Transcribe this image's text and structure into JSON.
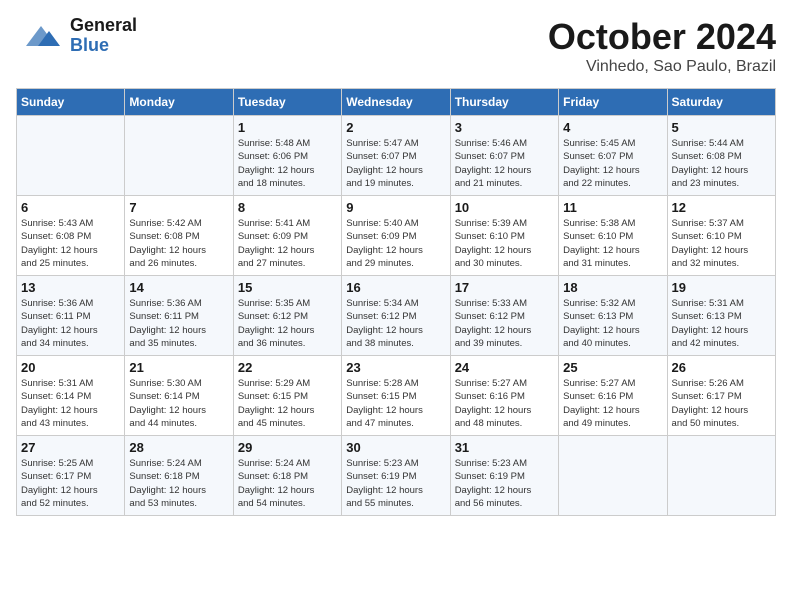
{
  "header": {
    "title": "October 2024",
    "subtitle": "Vinhedo, Sao Paulo, Brazil",
    "logo_general": "General",
    "logo_blue": "Blue"
  },
  "calendar": {
    "days_of_week": [
      "Sunday",
      "Monday",
      "Tuesday",
      "Wednesday",
      "Thursday",
      "Friday",
      "Saturday"
    ],
    "weeks": [
      [
        {
          "num": "",
          "detail": ""
        },
        {
          "num": "",
          "detail": ""
        },
        {
          "num": "1",
          "detail": "Sunrise: 5:48 AM\nSunset: 6:06 PM\nDaylight: 12 hours\nand 18 minutes."
        },
        {
          "num": "2",
          "detail": "Sunrise: 5:47 AM\nSunset: 6:07 PM\nDaylight: 12 hours\nand 19 minutes."
        },
        {
          "num": "3",
          "detail": "Sunrise: 5:46 AM\nSunset: 6:07 PM\nDaylight: 12 hours\nand 21 minutes."
        },
        {
          "num": "4",
          "detail": "Sunrise: 5:45 AM\nSunset: 6:07 PM\nDaylight: 12 hours\nand 22 minutes."
        },
        {
          "num": "5",
          "detail": "Sunrise: 5:44 AM\nSunset: 6:08 PM\nDaylight: 12 hours\nand 23 minutes."
        }
      ],
      [
        {
          "num": "6",
          "detail": "Sunrise: 5:43 AM\nSunset: 6:08 PM\nDaylight: 12 hours\nand 25 minutes."
        },
        {
          "num": "7",
          "detail": "Sunrise: 5:42 AM\nSunset: 6:08 PM\nDaylight: 12 hours\nand 26 minutes."
        },
        {
          "num": "8",
          "detail": "Sunrise: 5:41 AM\nSunset: 6:09 PM\nDaylight: 12 hours\nand 27 minutes."
        },
        {
          "num": "9",
          "detail": "Sunrise: 5:40 AM\nSunset: 6:09 PM\nDaylight: 12 hours\nand 29 minutes."
        },
        {
          "num": "10",
          "detail": "Sunrise: 5:39 AM\nSunset: 6:10 PM\nDaylight: 12 hours\nand 30 minutes."
        },
        {
          "num": "11",
          "detail": "Sunrise: 5:38 AM\nSunset: 6:10 PM\nDaylight: 12 hours\nand 31 minutes."
        },
        {
          "num": "12",
          "detail": "Sunrise: 5:37 AM\nSunset: 6:10 PM\nDaylight: 12 hours\nand 32 minutes."
        }
      ],
      [
        {
          "num": "13",
          "detail": "Sunrise: 5:36 AM\nSunset: 6:11 PM\nDaylight: 12 hours\nand 34 minutes."
        },
        {
          "num": "14",
          "detail": "Sunrise: 5:36 AM\nSunset: 6:11 PM\nDaylight: 12 hours\nand 35 minutes."
        },
        {
          "num": "15",
          "detail": "Sunrise: 5:35 AM\nSunset: 6:12 PM\nDaylight: 12 hours\nand 36 minutes."
        },
        {
          "num": "16",
          "detail": "Sunrise: 5:34 AM\nSunset: 6:12 PM\nDaylight: 12 hours\nand 38 minutes."
        },
        {
          "num": "17",
          "detail": "Sunrise: 5:33 AM\nSunset: 6:12 PM\nDaylight: 12 hours\nand 39 minutes."
        },
        {
          "num": "18",
          "detail": "Sunrise: 5:32 AM\nSunset: 6:13 PM\nDaylight: 12 hours\nand 40 minutes."
        },
        {
          "num": "19",
          "detail": "Sunrise: 5:31 AM\nSunset: 6:13 PM\nDaylight: 12 hours\nand 42 minutes."
        }
      ],
      [
        {
          "num": "20",
          "detail": "Sunrise: 5:31 AM\nSunset: 6:14 PM\nDaylight: 12 hours\nand 43 minutes."
        },
        {
          "num": "21",
          "detail": "Sunrise: 5:30 AM\nSunset: 6:14 PM\nDaylight: 12 hours\nand 44 minutes."
        },
        {
          "num": "22",
          "detail": "Sunrise: 5:29 AM\nSunset: 6:15 PM\nDaylight: 12 hours\nand 45 minutes."
        },
        {
          "num": "23",
          "detail": "Sunrise: 5:28 AM\nSunset: 6:15 PM\nDaylight: 12 hours\nand 47 minutes."
        },
        {
          "num": "24",
          "detail": "Sunrise: 5:27 AM\nSunset: 6:16 PM\nDaylight: 12 hours\nand 48 minutes."
        },
        {
          "num": "25",
          "detail": "Sunrise: 5:27 AM\nSunset: 6:16 PM\nDaylight: 12 hours\nand 49 minutes."
        },
        {
          "num": "26",
          "detail": "Sunrise: 5:26 AM\nSunset: 6:17 PM\nDaylight: 12 hours\nand 50 minutes."
        }
      ],
      [
        {
          "num": "27",
          "detail": "Sunrise: 5:25 AM\nSunset: 6:17 PM\nDaylight: 12 hours\nand 52 minutes."
        },
        {
          "num": "28",
          "detail": "Sunrise: 5:24 AM\nSunset: 6:18 PM\nDaylight: 12 hours\nand 53 minutes."
        },
        {
          "num": "29",
          "detail": "Sunrise: 5:24 AM\nSunset: 6:18 PM\nDaylight: 12 hours\nand 54 minutes."
        },
        {
          "num": "30",
          "detail": "Sunrise: 5:23 AM\nSunset: 6:19 PM\nDaylight: 12 hours\nand 55 minutes."
        },
        {
          "num": "31",
          "detail": "Sunrise: 5:23 AM\nSunset: 6:19 PM\nDaylight: 12 hours\nand 56 minutes."
        },
        {
          "num": "",
          "detail": ""
        },
        {
          "num": "",
          "detail": ""
        }
      ]
    ]
  }
}
